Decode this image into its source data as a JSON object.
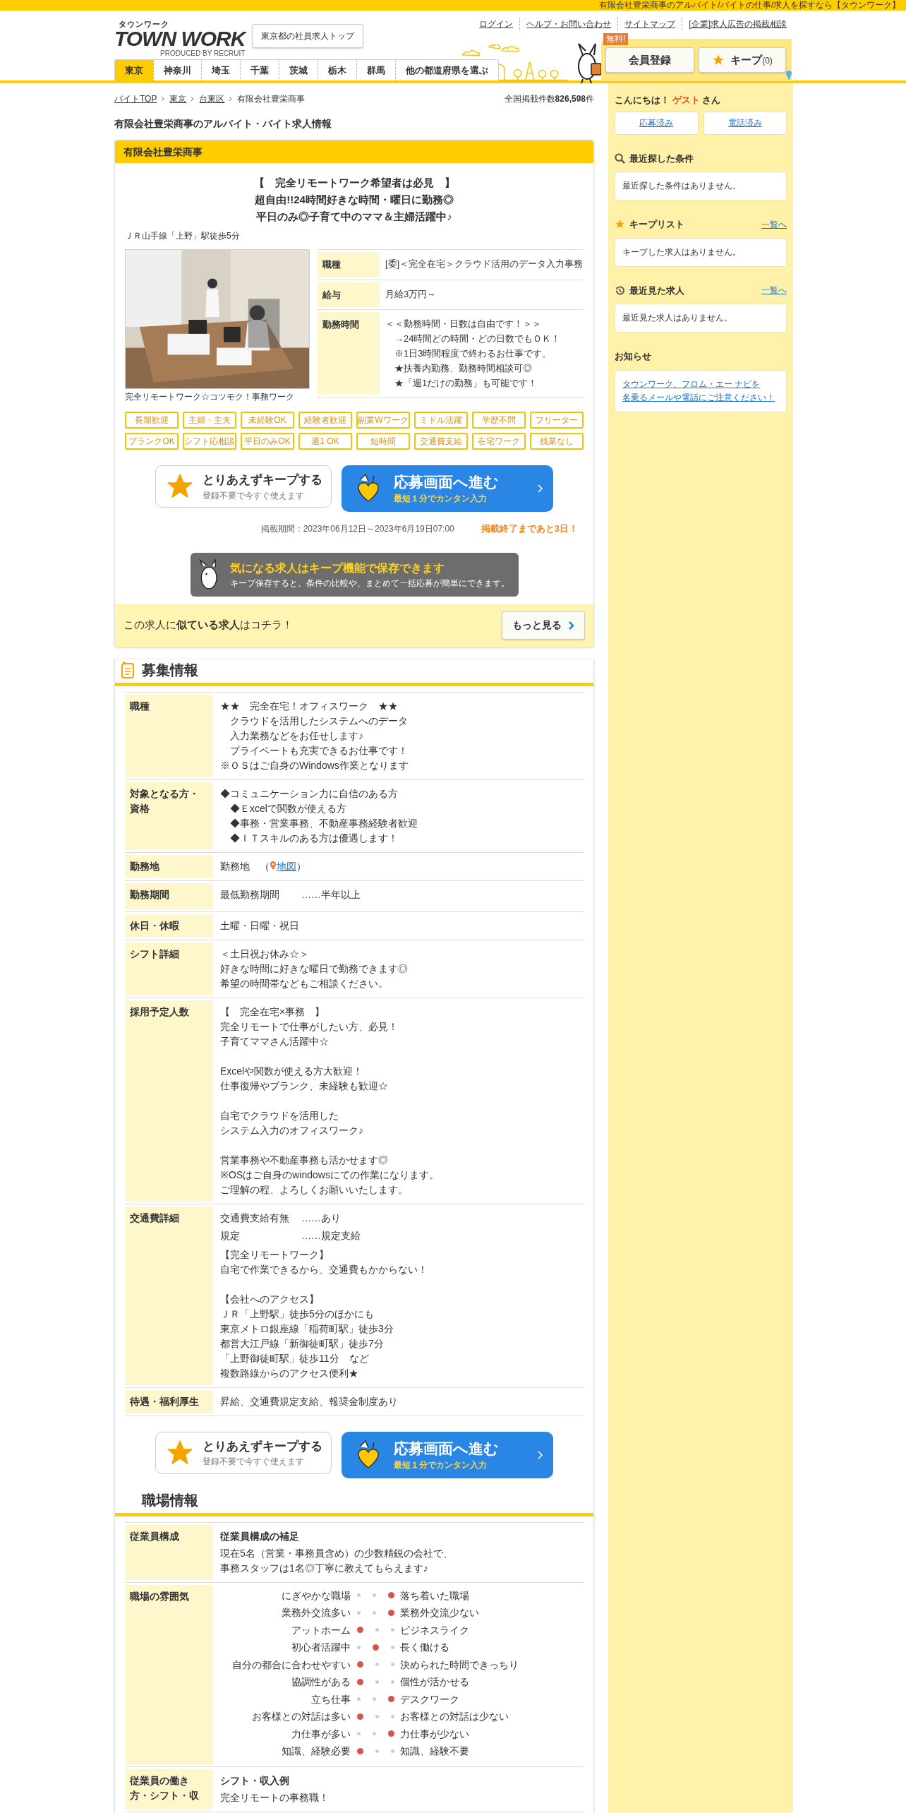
{
  "top_bar": {
    "text": "有限会社豊栄商事のアルバイト/バイトの仕事/求人を探すなら【タウンワーク】"
  },
  "header": {
    "logo": {
      "kana": "タウンワーク",
      "wordmark": "TOWN WORK",
      "credit": "PRODUCED BY RECRUIT"
    },
    "tokyo_button": "東京都の社員求人トップ",
    "links": [
      "ログイン",
      "ヘルプ・お問い合わせ",
      "サイトマップ",
      "[企業]求人広告の掲載相談"
    ],
    "free_badge": "無料!",
    "register_button": "会員登録",
    "keep_button": {
      "label": "キープ",
      "count": "(0)"
    },
    "tabs": [
      {
        "label": "東京",
        "selected": true
      },
      {
        "label": "神奈川",
        "selected": false
      },
      {
        "label": "埼玉",
        "selected": false
      },
      {
        "label": "千葉",
        "selected": false
      },
      {
        "label": "茨城",
        "selected": false
      },
      {
        "label": "栃木",
        "selected": false
      },
      {
        "label": "群馬",
        "selected": false
      },
      {
        "label": "他の都道府県を選ぶ",
        "selected": false
      }
    ]
  },
  "breadcrumbs": [
    "バイトTOP",
    "東京",
    "台東区",
    "有限会社豊栄商事"
  ],
  "total_count": "全国掲載件数**826,598**件",
  "page_title": "有限会社豊栄商事のアルバイト・バイト求人情報",
  "job": {
    "company": "有限会社豊栄商事",
    "catch": [
      "【　完全リモートワーク希望者は必見　】",
      "超自由!!24時間好きな時間・曜日に勤務◎",
      "平日のみ◎子育て中のママ＆主婦活躍中♪"
    ],
    "station": "ＪＲ山手線「上野」駅徒歩5分",
    "photo": {
      "kind": "picture",
      "caption": "完全リモートワーク☆コツモク！事務ワーク"
    },
    "summary": [
      {
        "label": "職種",
        "lines": [
          "[委]＜完全在宅＞クラウド活用のデータ入力事務"
        ]
      },
      {
        "label": "給与",
        "lines": [
          "月給3万円～"
        ]
      },
      {
        "label": "勤務時間",
        "lines": [
          "＜＜勤務時間・日数は自由です！＞＞",
          "　→24時間どの時間・どの日数でもＯＫ！",
          "　※1日3時間程度で終わるお仕事です。",
          "　★扶養内勤務、勤務時間相談可◎",
          "　★「週1だけの勤務」も可能です！"
        ]
      }
    ],
    "tags": [
      "長期歓迎",
      "主婦・主夫",
      "未経験OK",
      "経験者歓迎",
      "副業Wワーク",
      "ミドル活躍",
      "学歴不問",
      "フリーター",
      "ブランクOK",
      "シフト応相談",
      "平日のみOK",
      "週1 OK",
      "短時間",
      "交通費支給",
      "在宅ワーク",
      "残業なし"
    ],
    "keep_cta": {
      "title": "とりあえずキープする",
      "sub": "登録不要で今すぐ使えます"
    },
    "apply_cta": {
      "title": "応募画面へ進む",
      "sub": "最短１分でカンタン入力"
    },
    "period": "掲載期間：2023年06月12日～2023年6月19日07:00",
    "remaining": "掲載終了まであと**3**日！",
    "keep_banner": {
      "title": "気になる求人はキープ機能で保存できます",
      "sub": "キープ保存すると、条件の比較や、まとめて一括応募が簡単にできます。"
    },
    "similar": {
      "text": "この求人に**似ている求人**はコチラ！",
      "button": "もっと見る"
    }
  },
  "recruit": {
    "heading": "募集情報",
    "rows": [
      {
        "label": "職種",
        "paragraphs": [
          [
            "★★　完全在宅！オフィスワーク　★★",
            "　クラウドを活用したシステムへのデータ",
            "　入力業務などをお任せします♪",
            "　プライベートも充実できるお仕事です！",
            "※ＯＳはご自身のWindows作業となります"
          ]
        ]
      },
      {
        "label": "対象となる方・資格",
        "paragraphs": [
          [
            "◆コミュニケーション力に自信のある方",
            "　◆Ｅxcelで関数が使える方",
            "　◆事務・営業事務、不動産事務経験者歓迎",
            "　◆ＩＴスキルのある方は優遇します！"
          ]
        ]
      },
      {
        "label": "勤務地",
        "place": {
          "text": "勤務地　（",
          "link": "地図",
          "after": "）"
        }
      },
      {
        "label": "勤務期間",
        "pairs": [
          {
            "key": "最低勤務期間",
            "value": "……半年以上"
          }
        ]
      },
      {
        "label": "休日・休暇",
        "paragraphs": [
          [
            "土曜・日曜・祝日"
          ]
        ]
      },
      {
        "label": "シフト詳細",
        "paragraphs": [
          [
            "＜土日祝お休み☆＞",
            "好きな時間に好きな曜日で勤務できます◎",
            "希望の時間帯などもご相談ください。"
          ]
        ]
      },
      {
        "label": "採用予定人数",
        "paragraphs": [
          [
            "【　完全在宅×事務　】",
            "完全リモートで仕事がしたい方、必見！",
            "子育てママさん活躍中☆"
          ],
          [
            "Excelや関数が使える方大歓迎！",
            "仕事復帰やブランク、未経験も歓迎☆"
          ],
          [
            "自宅でクラウドを活用した",
            "システム入力のオフィスワーク♪"
          ],
          [
            "営業事務や不動産事務も活かせます◎",
            "※OSはご自身のwindowsにての作業になります。",
            "ご理解の程、よろしくお願いいたします。"
          ]
        ]
      },
      {
        "label": "交通費詳細",
        "pairs": [
          {
            "key": "交通費支給有無",
            "value": "……あり"
          },
          {
            "key": "規定",
            "value": "……規定支給"
          }
        ],
        "paragraphs": [
          [
            "【完全リモートワーク】",
            "自宅で作業できるから、交通費もかからない！"
          ],
          [
            "【会社へのアクセス】",
            "ＪＲ「上野駅」徒歩5分のほかにも",
            "東京メトロ銀座線「稲荷町駅」徒歩3分",
            "都営大江戸線「新御徒町駅」徒歩7分",
            "「上野御徒町駅」徒歩11分　など",
            "複数路線からのアクセス便利★"
          ]
        ]
      },
      {
        "label": "待遇・福利厚生",
        "paragraphs": [
          [
            "昇給、交通費規定支給、報奨金制度あり"
          ]
        ]
      }
    ]
  },
  "keep_cta_2": {
    "title": "とりあえずキープする",
    "sub": "登録不要で今すぐ使えます"
  },
  "apply_cta_2": {
    "title": "応募画面へ進む",
    "sub": "最短１分でカンタン入力"
  },
  "workplace": {
    "heading": "職場情報",
    "rows": [
      {
        "label": "従業員構成",
        "subtitle": "従業員構成の補足",
        "paragraphs": [
          [
            "現在5名（営業・事務員含め）の少数精鋭の会社で、",
            "事務スタッフは1名◎丁寧に教えてもらえます♪"
          ]
        ]
      },
      {
        "label": "職場の雰囲気",
        "atmosphere": [
          {
            "left": "にぎやかな職場",
            "right": "落ち着いた職場",
            "scale": [
              {
                "selected": false
              },
              {
                "selected": false
              },
              {
                "selected": true
              }
            ]
          },
          {
            "left": "業務外交流多い",
            "right": "業務外交流少ない",
            "scale": [
              {
                "selected": false
              },
              {
                "selected": false
              },
              {
                "selected": true
              }
            ]
          },
          {
            "left": "アットホーム",
            "right": "ビジネスライク",
            "scale": [
              {
                "selected": true
              },
              {
                "selected": false
              },
              {
                "selected": false
              }
            ]
          },
          {
            "left": "初心者活躍中",
            "right": "長く働ける",
            "scale": [
              {
                "selected": false
              },
              {
                "selected": true
              },
              {
                "selected": false
              }
            ]
          },
          {
            "left": "自分の都合に合わせやすい",
            "right": "決められた時間できっちり",
            "scale": [
              {
                "selected": true
              },
              {
                "selected": false
              },
              {
                "selected": false
              }
            ]
          },
          {
            "left": "協調性がある",
            "right": "個性が活かせる",
            "scale": [
              {
                "selected": true
              },
              {
                "selected": false
              },
              {
                "selected": false
              }
            ]
          },
          {
            "left": "立ち仕事",
            "right": "デスクワーク",
            "scale": [
              {
                "selected": false
              },
              {
                "selected": false
              },
              {
                "selected": true
              }
            ]
          },
          {
            "left": "お客様との対話は多い",
            "right": "お客様との対話は少ない",
            "scale": [
              {
                "selected": true
              },
              {
                "selected": false
              },
              {
                "selected": false
              }
            ]
          },
          {
            "left": "力仕事が多い",
            "right": "力仕事が少ない",
            "scale": [
              {
                "selected": false
              },
              {
                "selected": false
              },
              {
                "selected": true
              }
            ]
          },
          {
            "left": "知識、経験必要",
            "right": "知識、経験不要",
            "scale": [
              {
                "selected": true
              },
              {
                "selected": false
              },
              {
                "selected": false
              }
            ]
          }
        ]
      },
      {
        "label": "従業員の働き方・シフト・収",
        "subtitle": "シフト・収入例",
        "paragraphs": [
          [
            "完全リモートの事務職！"
          ]
        ]
      }
    ]
  },
  "sidebar": {
    "greeting": {
      "before": "こんにちは！",
      "name": "ゲスト",
      "after": "さん"
    },
    "buttons": [
      "応募済み",
      "電話済み"
    ],
    "sections": [
      {
        "kind": "search",
        "title": "最近探した条件",
        "body": "最近探した条件はありません。"
      },
      {
        "kind": "keep",
        "title": "キープリスト",
        "link": "一覧へ",
        "body": "キープした求人はありません。"
      },
      {
        "kind": "history",
        "title": "最近見た求人",
        "link": "一覧へ",
        "body": "最近見た求人はありません。"
      },
      {
        "kind": "notice",
        "title": "お知らせ",
        "notice_link": [
          "タウンワーク、フロム・エー ナビを",
          "名乗るメールや電話にご注意ください！"
        ]
      }
    ]
  }
}
